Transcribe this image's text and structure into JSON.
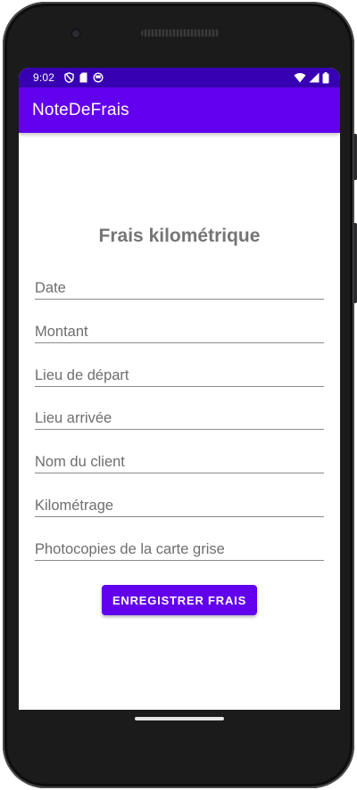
{
  "status_bar": {
    "time": "9:02",
    "icons_left": [
      "shield-icon",
      "sd-card-icon",
      "notification-icon"
    ],
    "icons_right": [
      "wifi-icon",
      "signal-icon",
      "battery-icon"
    ],
    "color": "#3700b3"
  },
  "app_bar": {
    "title": "NoteDeFrais",
    "color": "#6200ee"
  },
  "form": {
    "title": "Frais kilométrique",
    "fields": [
      {
        "placeholder": "Date"
      },
      {
        "placeholder": "Montant"
      },
      {
        "placeholder": "Lieu de départ"
      },
      {
        "placeholder": "Lieu arrivée"
      },
      {
        "placeholder": "Nom du client"
      },
      {
        "placeholder": "Kilométrage"
      },
      {
        "placeholder": "Photocopies de la carte grise"
      }
    ],
    "save_label": "ENREGISTRER FRAIS",
    "accent": "#6200ee"
  }
}
